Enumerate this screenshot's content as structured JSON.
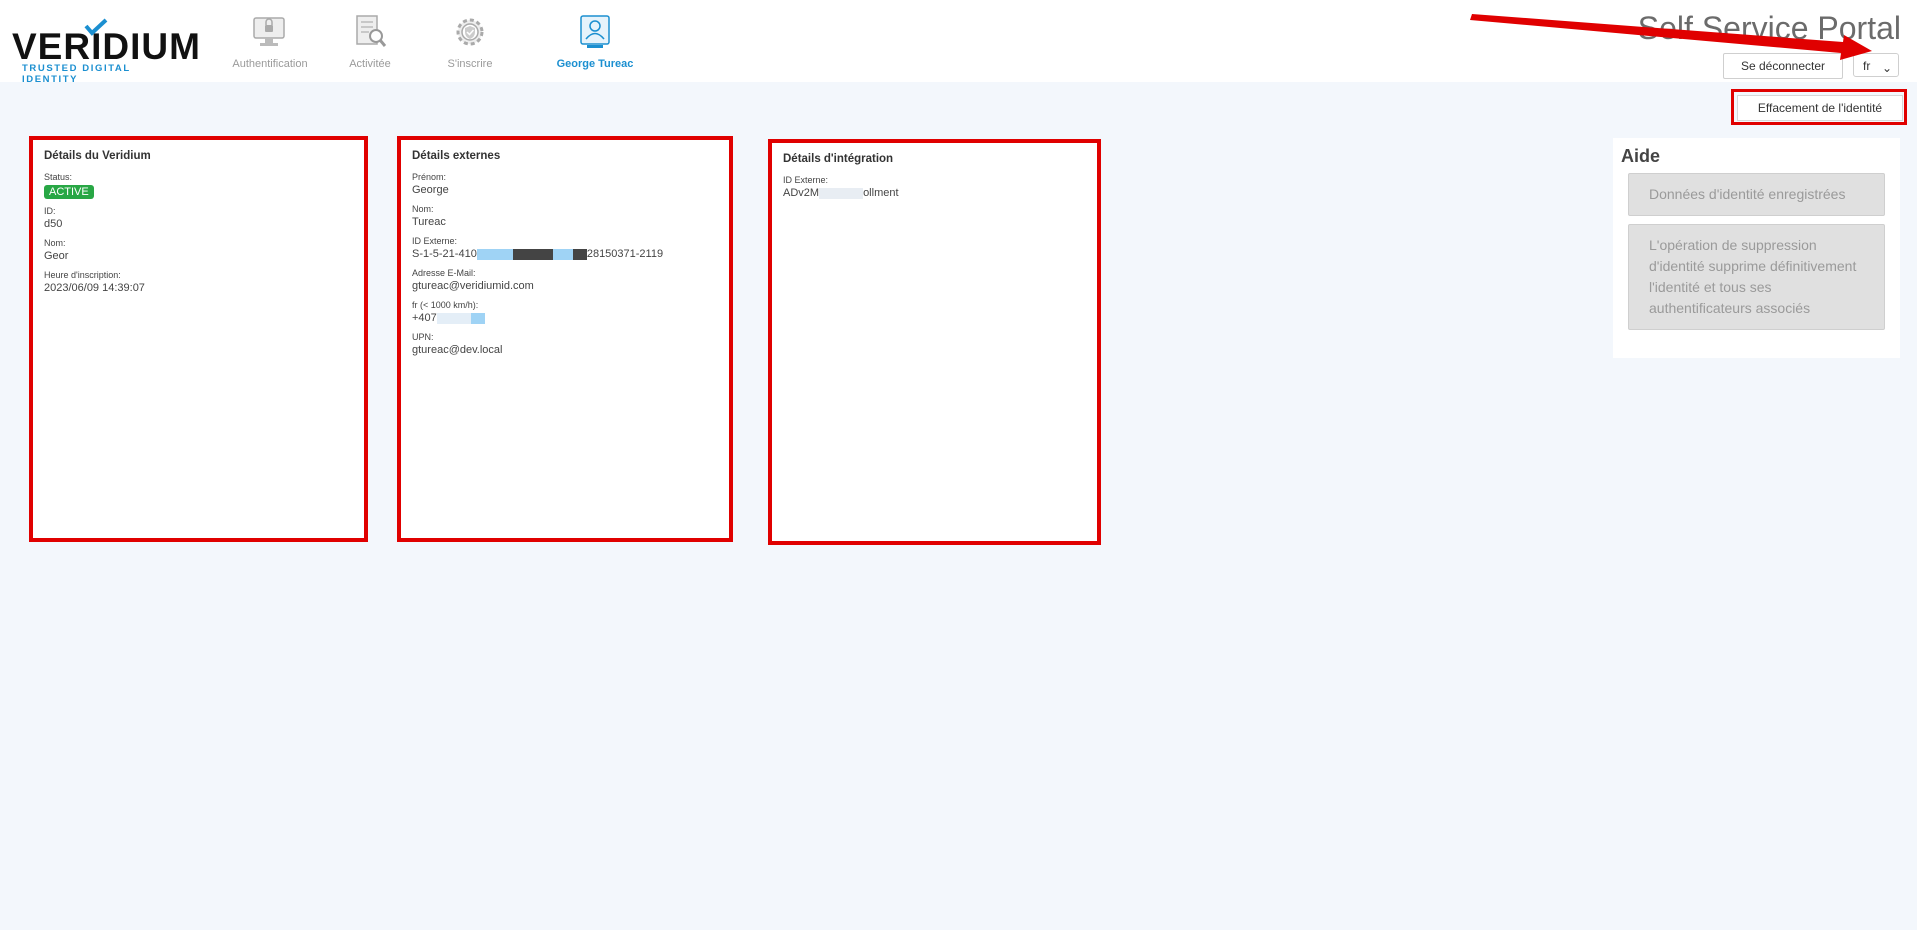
{
  "logo": {
    "word": "VERIDIUM",
    "tagline": "TRUSTED DIGITAL IDENTITY"
  },
  "nav": [
    {
      "label": "Authentification",
      "icon": "monitor-lock-icon"
    },
    {
      "label": "Activitée",
      "icon": "document-search-icon"
    },
    {
      "label": "S'inscrire",
      "icon": "gear-shield-icon"
    },
    {
      "label": "George Tureac",
      "icon": "user-id-card-icon",
      "active": true
    }
  ],
  "header": {
    "portal_title": "Self Service Portal",
    "logout_label": "Se déconnecter",
    "language_value": "fr"
  },
  "actions": {
    "erase_identity_label": "Effacement de l'identité"
  },
  "card_veridium": {
    "title": "Détails du Veridium",
    "status_label": "Status:",
    "status_value": "ACTIVE",
    "id_label": "ID:",
    "id_value": "d50",
    "name_label": "Nom:",
    "name_value": "Geor",
    "enroll_label": "Heure d'inscription:",
    "enroll_value": "2023/06/09 14:39:07"
  },
  "card_external": {
    "title": "Détails externes",
    "firstname_label": "Prénom:",
    "firstname_value": "George",
    "lastname_label": "Nom:",
    "lastname_value": "Tureac",
    "extid_label": "ID Externe:",
    "extid_prefix": "S-1-5-21-410",
    "extid_suffix": "28150371-2119",
    "email_label": "Adresse E-Mail:",
    "email_value": "gtureac@veridiumid.com",
    "phone_label": "fr (< 1000 km/h):",
    "phone_value": "+407",
    "upn_label": "UPN:",
    "upn_value": "gtureac@dev.local"
  },
  "card_integration": {
    "title": "Détails d'intégration",
    "extid_label": "ID Externe:",
    "extid_prefix": "ADv2M",
    "extid_suffix": "ollment"
  },
  "aide": {
    "title": "Aide",
    "items": [
      "Données d'identité enregistrées",
      "L'opération de suppression d'identité supprime définitivement l'identité et tous ses authentificateurs associés"
    ]
  },
  "colors": {
    "accent": "#1b8fd0",
    "annotation_red": "#e00000",
    "status_green": "#28a745",
    "page_bg": "#f3f7fc"
  }
}
